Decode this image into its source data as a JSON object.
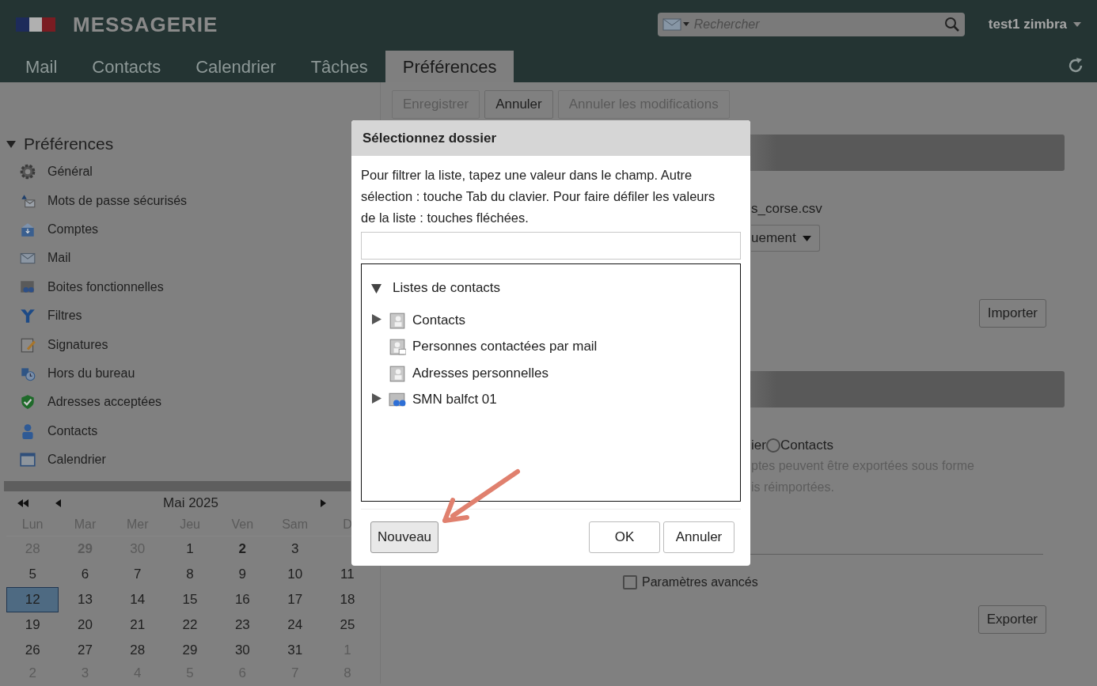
{
  "app": {
    "title": "MESSAGERIE",
    "search": {
      "placeholder": "Rechercher"
    },
    "user": "test1 zimbra"
  },
  "tabs": [
    {
      "label": "Mail",
      "selected": false
    },
    {
      "label": "Contacts",
      "selected": false
    },
    {
      "label": "Calendrier",
      "selected": false
    },
    {
      "label": "Tâches",
      "selected": false
    },
    {
      "label": "Préférences",
      "selected": true
    }
  ],
  "toolbar": [
    {
      "label": "Enregistrer",
      "disabled": true
    },
    {
      "label": "Annuler",
      "disabled": false
    },
    {
      "label": "Annuler les modifications",
      "disabled": true
    }
  ],
  "sidebar": {
    "title": "Préférences",
    "expanded": true,
    "items": [
      {
        "label": "Général"
      },
      {
        "label": "Mots de passe sécurisés"
      },
      {
        "label": "Comptes"
      },
      {
        "label": "Mail"
      },
      {
        "label": "Boites fonctionnelles"
      },
      {
        "label": "Filtres"
      },
      {
        "label": "Signatures"
      },
      {
        "label": "Hors du bureau"
      },
      {
        "label": "Adresses acceptées"
      },
      {
        "label": "Contacts"
      },
      {
        "label": "Calendrier"
      }
    ]
  },
  "calendar": {
    "month": "Mai 2025",
    "weekdays": [
      "Lun",
      "Mar",
      "Mer",
      "Jeu",
      "Ven",
      "Sam",
      "D"
    ],
    "weeks": [
      [
        {
          "day": "28",
          "other_month": true,
          "bold": false,
          "selected": false
        },
        {
          "day": "29",
          "other_month": true,
          "bold": true,
          "selected": false
        },
        {
          "day": "30",
          "other_month": true,
          "bold": false,
          "selected": false
        },
        {
          "day": "1",
          "other_month": false,
          "bold": false,
          "selected": false
        },
        {
          "day": "2",
          "other_month": false,
          "bold": true,
          "selected": false
        },
        {
          "day": "3",
          "other_month": false,
          "bold": false,
          "selected": false
        }
      ],
      [
        {
          "day": "5",
          "other_month": false,
          "bold": false,
          "selected": false
        },
        {
          "day": "6",
          "other_month": false,
          "bold": false,
          "selected": false
        },
        {
          "day": "7",
          "other_month": false,
          "bold": false,
          "selected": false
        },
        {
          "day": "8",
          "other_month": false,
          "bold": false,
          "selected": false
        },
        {
          "day": "9",
          "other_month": false,
          "bold": false,
          "selected": false
        },
        {
          "day": "10",
          "other_month": false,
          "bold": false,
          "selected": false
        },
        {
          "day": "11",
          "other_month": false,
          "bold": false,
          "selected": false
        }
      ],
      [
        {
          "day": "12",
          "other_month": false,
          "bold": false,
          "selected": true
        },
        {
          "day": "13",
          "other_month": false,
          "bold": false,
          "selected": false
        },
        {
          "day": "14",
          "other_month": false,
          "bold": false,
          "selected": false
        },
        {
          "day": "15",
          "other_month": false,
          "bold": false,
          "selected": false
        },
        {
          "day": "16",
          "other_month": false,
          "bold": false,
          "selected": false
        },
        {
          "day": "17",
          "other_month": false,
          "bold": false,
          "selected": false
        },
        {
          "day": "18",
          "other_month": false,
          "bold": false,
          "selected": false
        }
      ],
      [
        {
          "day": "19",
          "other_month": false,
          "bold": false,
          "selected": false
        },
        {
          "day": "20",
          "other_month": false,
          "bold": false,
          "selected": false
        },
        {
          "day": "21",
          "other_month": false,
          "bold": false,
          "selected": false
        },
        {
          "day": "22",
          "other_month": false,
          "bold": false,
          "selected": false
        },
        {
          "day": "23",
          "other_month": false,
          "bold": false,
          "selected": false
        },
        {
          "day": "24",
          "other_month": false,
          "bold": false,
          "selected": false
        },
        {
          "day": "25",
          "other_month": false,
          "bold": false,
          "selected": false
        }
      ],
      [
        {
          "day": "26",
          "other_month": false,
          "bold": false,
          "selected": false
        },
        {
          "day": "27",
          "other_month": false,
          "bold": false,
          "selected": false
        },
        {
          "day": "28",
          "other_month": false,
          "bold": false,
          "selected": false
        },
        {
          "day": "29",
          "other_month": false,
          "bold": false,
          "selected": false
        },
        {
          "day": "30",
          "other_month": false,
          "bold": false,
          "selected": false
        },
        {
          "day": "31",
          "other_month": false,
          "bold": false,
          "selected": false
        },
        {
          "day": "1",
          "other_month": true,
          "bold": false,
          "selected": false
        }
      ],
      [
        {
          "day": "2",
          "other_month": true,
          "bold": false,
          "selected": false
        },
        {
          "day": "3",
          "other_month": true,
          "bold": false,
          "selected": false
        },
        {
          "day": "4",
          "other_month": true,
          "bold": false,
          "selected": false
        },
        {
          "day": "5",
          "other_month": true,
          "bold": false,
          "selected": false
        },
        {
          "day": "6",
          "other_month": true,
          "bold": false,
          "selected": false
        },
        {
          "day": "7",
          "other_month": true,
          "bold": false,
          "selected": false
        },
        {
          "day": "8",
          "other_month": true,
          "bold": false,
          "selected": false
        }
      ]
    ]
  },
  "panel": {
    "file_name": "s_corse.csv",
    "dropdown": "uement",
    "import_button": "Importer",
    "radio_prefix": "ier",
    "radio": {
      "label": "Contacts",
      "selected": false
    },
    "note_lines": [
      "ptes peuvent être exportées sous forme",
      "is réimportées."
    ],
    "advanced": {
      "label": "Paramètres avancés",
      "checked": false
    },
    "export_button": "Exporter"
  },
  "dialog": {
    "title": "Sélectionnez dossier",
    "hint": "Pour filtrer la liste, tapez une valeur dans le champ. Autre sélection : touche Tab du clavier. Pour faire défiler les valeurs de la liste : touches fléchées.",
    "tree": {
      "label": "Listes de contacts",
      "expanded": true,
      "children": [
        {
          "label": "Contacts",
          "expanded": false
        },
        {
          "label": "Personnes contactées par mail"
        },
        {
          "label": "Adresses personnelles"
        },
        {
          "label": "SMN balfct 01",
          "expanded": false
        }
      ]
    },
    "new_button": "Nouveau",
    "ok_button": "OK",
    "cancel_button": "Annuler"
  }
}
